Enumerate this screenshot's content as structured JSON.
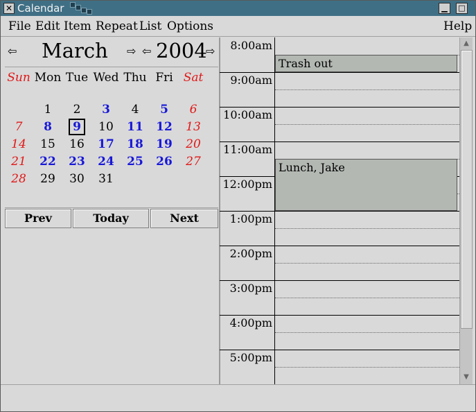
{
  "window": {
    "title": "Calendar",
    "close_glyph": "✕",
    "minimize_glyph": "▁",
    "maximize_glyph": "□"
  },
  "menu": {
    "file": "File",
    "edit": "Edit",
    "item": "Item",
    "repeat": "Repeat",
    "list": "List",
    "options": "Options",
    "help": "Help"
  },
  "calendar": {
    "month": "March",
    "year": "2004",
    "prev_arrow": "⇦",
    "next_arrow": "⇨",
    "weekdays": [
      "Sun",
      "Mon",
      "Tue",
      "Wed",
      "Thu",
      "Fri",
      "Sat"
    ],
    "weeks": [
      [
        "",
        "1",
        "2",
        "3",
        "4",
        "5",
        "6"
      ],
      [
        "7",
        "8",
        "9",
        "10",
        "11",
        "12",
        "13"
      ],
      [
        "14",
        "15",
        "16",
        "17",
        "18",
        "19",
        "20"
      ],
      [
        "21",
        "22",
        "23",
        "24",
        "25",
        "26",
        "27"
      ],
      [
        "28",
        "29",
        "30",
        "31",
        "",
        "",
        ""
      ]
    ],
    "appointment_days": [
      "3",
      "5",
      "8",
      "9",
      "11",
      "12",
      "17",
      "18",
      "19",
      "22",
      "23",
      "24",
      "25",
      "26"
    ],
    "selected_day": "9"
  },
  "nav": {
    "prev": "Prev",
    "today": "Today",
    "next": "Next"
  },
  "schedule": {
    "hours": [
      "8:00am",
      "9:00am",
      "10:00am",
      "11:00am",
      "12:00pm",
      "1:00pm",
      "2:00pm",
      "3:00pm",
      "4:00pm",
      "5:00pm"
    ],
    "appointments": [
      {
        "text": "Trash out",
        "start": "8:30am",
        "end": "9:00am"
      },
      {
        "text": "Lunch, Jake",
        "start": "11:30am",
        "end": "1:00pm"
      }
    ]
  },
  "colors": {
    "titlebar": "#3f6f85",
    "weekend": "#e01818",
    "appointment_day": "#1818d8",
    "appointment_block": "#b3b8b3"
  }
}
